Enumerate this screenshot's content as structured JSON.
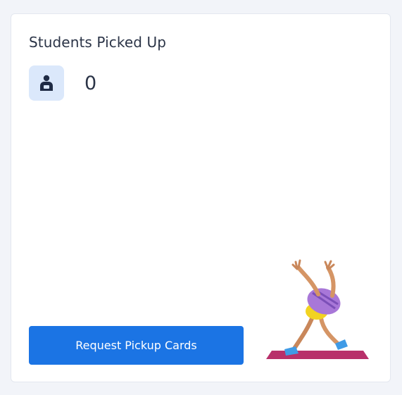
{
  "card": {
    "title": "Students Picked Up",
    "count": "0",
    "icon": "student-badge-icon",
    "button_label": "Request Pickup Cards",
    "illustration": "stretching-figure-on-yoga-mat",
    "colors": {
      "accent": "#1b74e4",
      "icon_bg": "#dbe8fb",
      "icon_fg": "#1f2b45",
      "text": "#2b3447"
    }
  }
}
